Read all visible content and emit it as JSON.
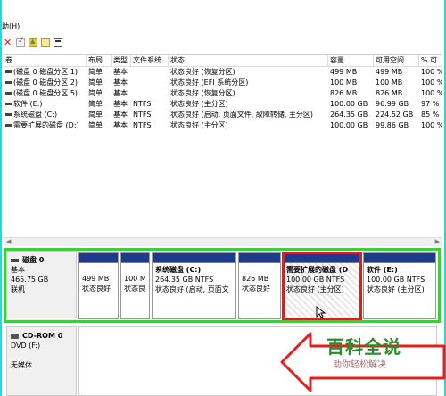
{
  "menu": {
    "help": "助(H)"
  },
  "toolbar": {
    "icons": [
      "delete-icon",
      "properties-icon",
      "up-folder-icon",
      "document-icon",
      "window-icon"
    ]
  },
  "table": {
    "headers": [
      "卷",
      "布局",
      "类型",
      "文件系统",
      "状态",
      "容量",
      "可用空间",
      "% 可"
    ],
    "rows": [
      [
        "(磁盘 0 磁盘分区 1)",
        "简单",
        "基本",
        "",
        "状态良好 (恢复分区)",
        "499 MB",
        "499 MB",
        "100 %"
      ],
      [
        "(磁盘 0 磁盘分区 2)",
        "简单",
        "基本",
        "",
        "状态良好 (EFI 系统分区)",
        "100 MB",
        "100 MB",
        "100 %"
      ],
      [
        "(磁盘 0 磁盘分区 5)",
        "简单",
        "基本",
        "",
        "状态良好 (恢复分区)",
        "826 MB",
        "826 MB",
        "100 %"
      ],
      [
        "软件 (E:)",
        "简单",
        "基本",
        "NTFS",
        "状态良好 (主分区)",
        "100.00 GB",
        "96.99 GB",
        "97 %"
      ],
      [
        "系统磁盘 (C:)",
        "简单",
        "基本",
        "NTFS",
        "状态良好 (启动, 页面文件, 故障转储, 主分区)",
        "264.35 GB",
        "224.52 GB",
        "85 %"
      ],
      [
        "需要扩展的磁盘 (D:)",
        "简单",
        "基本",
        "NTFS",
        "状态良好 (主分区)",
        "100.00 GB",
        "99.86 GB",
        "100 %"
      ]
    ]
  },
  "disk0": {
    "name": "磁盘 0",
    "type": "基本",
    "size": "465.75 GB",
    "status": "联机",
    "partitions": [
      {
        "name": "",
        "size": "499 MB",
        "status": "状态良好"
      },
      {
        "name": "",
        "size": "100 M",
        "status": "状态良"
      },
      {
        "name": "系统磁盘 (C:)",
        "size": "264.35 GB NTFS",
        "status": "状态良好 (启动, 页面文"
      },
      {
        "name": "",
        "size": "826 MB",
        "status": "状态良好"
      },
      {
        "name": "需要扩展的磁盘 (D",
        "size": "100.00 GB NTFS",
        "status": "状态良好 (主分区)"
      },
      {
        "name": "软件 (E:)",
        "size": "100.00 GB NTFS",
        "status": "状态良好 (主分区)"
      }
    ]
  },
  "cdrom": {
    "name": "CD-ROM 0",
    "type": "DVD (F:)",
    "status": "无媒体"
  },
  "watermark": {
    "title": "百科全说",
    "subtitle": "助你轻松解决"
  },
  "colors": {
    "partition_bar": "#1e3a8a",
    "highlight_green": "#2fd82f",
    "selection_red": "#d81e1e",
    "frame_cyan": "#2bd7d2"
  }
}
